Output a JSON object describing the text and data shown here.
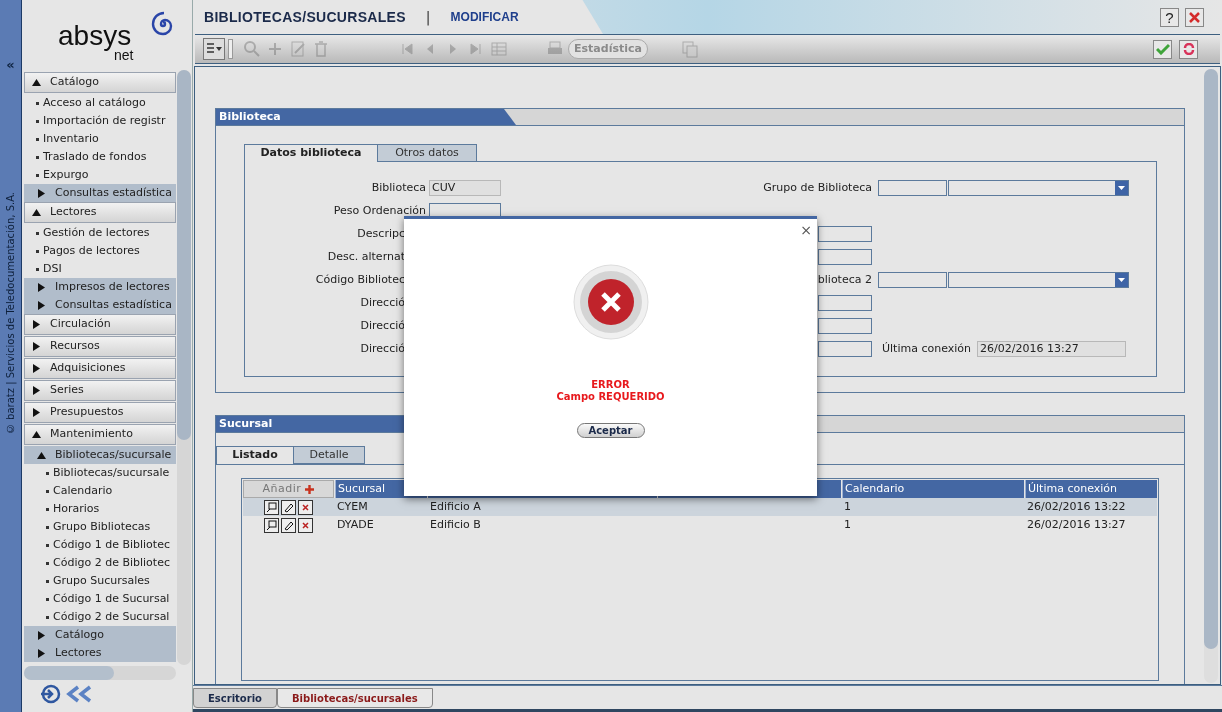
{
  "sidebar": {
    "copyright": "© baratz | Servicios de Teledocumentación, S.A.",
    "collapse": "«",
    "logo": {
      "name": "absys",
      "suffix": "net"
    },
    "menu": [
      {
        "kind": "section",
        "label": "Catálogo",
        "expanded": true,
        "children": [
          {
            "kind": "item",
            "label": "Acceso al catálogo"
          },
          {
            "kind": "item",
            "label": "Importación de registr"
          },
          {
            "kind": "item",
            "label": "Inventario"
          },
          {
            "kind": "item",
            "label": "Traslado de fondos"
          },
          {
            "kind": "item",
            "label": "Expurgo"
          },
          {
            "kind": "group",
            "label": "Consultas estadística",
            "expanded": false
          }
        ]
      },
      {
        "kind": "section",
        "label": "Lectores",
        "expanded": true,
        "children": [
          {
            "kind": "item",
            "label": "Gestión de lectores"
          },
          {
            "kind": "item",
            "label": "Pagos de lectores"
          },
          {
            "kind": "item",
            "label": "DSI"
          },
          {
            "kind": "group",
            "label": "Impresos de lectores",
            "expanded": false
          },
          {
            "kind": "group",
            "label": "Consultas estadística",
            "expanded": false
          }
        ]
      },
      {
        "kind": "section",
        "label": "Circulación",
        "expanded": false
      },
      {
        "kind": "section",
        "label": "Recursos",
        "expanded": false
      },
      {
        "kind": "section",
        "label": "Adquisiciones",
        "expanded": false
      },
      {
        "kind": "section",
        "label": "Series",
        "expanded": false
      },
      {
        "kind": "section",
        "label": "Presupuestos",
        "expanded": false
      },
      {
        "kind": "section",
        "label": "Mantenimiento",
        "expanded": true,
        "children": [
          {
            "kind": "group",
            "label": "Bibliotecas/sucursale",
            "expanded": true,
            "children": [
              {
                "kind": "item",
                "label": "Bibliotecas/sucursale"
              },
              {
                "kind": "item",
                "label": "Calendario"
              },
              {
                "kind": "item",
                "label": "Horarios"
              },
              {
                "kind": "item",
                "label": "Grupo Bibliotecas"
              },
              {
                "kind": "item",
                "label": "Código 1 de Bibliotec"
              },
              {
                "kind": "item",
                "label": "Código 2 de Bibliotec"
              },
              {
                "kind": "item",
                "label": "Grupo Sucursales"
              },
              {
                "kind": "item",
                "label": "Código 1 de Sucursal"
              },
              {
                "kind": "item",
                "label": "Código 2 de Sucursal"
              }
            ]
          },
          {
            "kind": "group",
            "label": "Catálogo",
            "expanded": false
          },
          {
            "kind": "group",
            "label": "Lectores",
            "expanded": false
          }
        ]
      }
    ]
  },
  "header": {
    "title": "BIBLIOTECAS/SUCURSALES",
    "separator": "|",
    "mode": "MODIFICAR",
    "help": "?"
  },
  "toolbar": {
    "stats_button": {
      "label": "Estadística",
      "disabled": true
    }
  },
  "biblioteca": {
    "title": "Biblioteca",
    "tabs": [
      {
        "label": "Datos biblioteca",
        "selected": true
      },
      {
        "label": "Otros datos",
        "selected": false
      }
    ],
    "rows": [
      {
        "left": {
          "kind": "field",
          "label": "Biblioteca",
          "value": "CUV",
          "readonly": true
        },
        "right": {
          "kind": "combo",
          "label": "Grupo de Biblioteca"
        }
      },
      {
        "left": {
          "kind": "field",
          "label": "Peso Ordenación",
          "readonly": false
        }
      },
      {
        "left": {
          "kind": "covered",
          "label": "Descripc"
        },
        "right": {
          "kind": "field"
        }
      },
      {
        "left": {
          "kind": "covered",
          "label": "Desc. alternat"
        },
        "right": {
          "kind": "field"
        }
      },
      {
        "left": {
          "kind": "covered",
          "label": "Código Bibliotec"
        },
        "right": {
          "kind": "combo",
          "label": "blioteca 2"
        }
      },
      {
        "left": {
          "kind": "covered",
          "label": "Direcció"
        },
        "right": {
          "kind": "field"
        }
      },
      {
        "left": {
          "kind": "covered",
          "label": "Direcció"
        },
        "right": {
          "kind": "field"
        }
      },
      {
        "left": {
          "kind": "covered",
          "label": "Direcció"
        },
        "right": {
          "kind": "field",
          "extra_label": "Última conexión",
          "extra_value": "26/02/2016 13:27"
        }
      }
    ]
  },
  "sucursal": {
    "title": "Sucursal",
    "tabs": [
      {
        "label": "Listado",
        "selected": true
      },
      {
        "label": "Detalle",
        "selected": false
      }
    ],
    "table": {
      "add_button": "Añadir",
      "columns": [
        {
          "kind": "labeled",
          "label": "Sucursal"
        },
        {
          "kind": "covered"
        },
        {
          "kind": "covered"
        },
        {
          "kind": "labeled",
          "label": "Calendario"
        },
        {
          "kind": "labeled",
          "label": "Última conexión"
        }
      ],
      "rows": [
        {
          "selected": true,
          "cells": [
            "CYEM",
            "Edificio A",
            "",
            "1",
            "26/02/2016 13:22"
          ]
        },
        {
          "selected": false,
          "cells": [
            "DYADE",
            "Edificio B",
            "",
            "1",
            "26/02/2016 13:27"
          ]
        }
      ]
    }
  },
  "modal": {
    "close": "×",
    "message_title": "ERROR",
    "message": "Campo REQUERIDO",
    "button": "Aceptar"
  },
  "footer_tabs": [
    {
      "label": "Escritorio",
      "selected": false
    },
    {
      "label": "Bibliotecas/sucursales",
      "selected": true
    }
  ]
}
